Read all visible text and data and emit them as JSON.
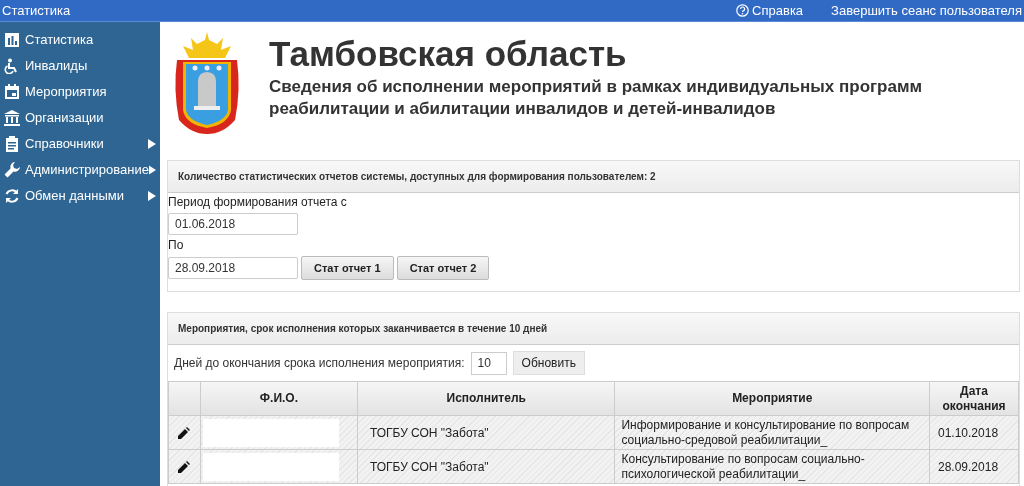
{
  "topbar": {
    "title": "Статистика",
    "help": "Справка",
    "logout": "Завершить сеанс пользователя"
  },
  "sidebar": {
    "items": [
      {
        "label": "Статистика",
        "submenu": false
      },
      {
        "label": "Инвалиды",
        "submenu": false
      },
      {
        "label": "Мероприятия",
        "submenu": false
      },
      {
        "label": "Организации",
        "submenu": false
      },
      {
        "label": "Справочники",
        "submenu": true
      },
      {
        "label": "Администрирование",
        "submenu": true
      },
      {
        "label": "Обмен данными",
        "submenu": true
      }
    ]
  },
  "header": {
    "title": "Тамбовская область",
    "subtitle": "Сведения об исполнении мероприятий в рамках индивидуальных программ реабилитации и абилитации инвалидов и детей-инвалидов"
  },
  "reports_panel": {
    "heading": "Количество статистических отчетов системы, доступных для формирования пользователем: 2",
    "from_label": "Период формирования отчета с",
    "from_value": "01.06.2018",
    "to_label": "По",
    "to_value": "28.09.2018",
    "buttons": [
      "Стат отчет 1",
      "Стат отчет 2"
    ]
  },
  "events_panel": {
    "heading": "Мероприятия, срок исполнения которых заканчивается в течение 10 дней",
    "days_label": "Дней до окончания срока исполнения мероприятия:",
    "days_value": "10",
    "refresh": "Обновить",
    "table": {
      "columns": [
        "Ф.И.О.",
        "Исполнитель",
        "Мероприятие",
        "Дата окончания"
      ],
      "rows": [
        {
          "executor": "ТОГБУ СОН \"Забота\"",
          "event": "Информирование и консультирование по вопросам социально-средовой реабилитации_",
          "date": "01.10.2018"
        },
        {
          "executor": "ТОГБУ СОН \"Забота\"",
          "event": "Консультирование по вопросам социально-психологической реабилитации_",
          "date": "28.09.2018"
        }
      ]
    }
  }
}
